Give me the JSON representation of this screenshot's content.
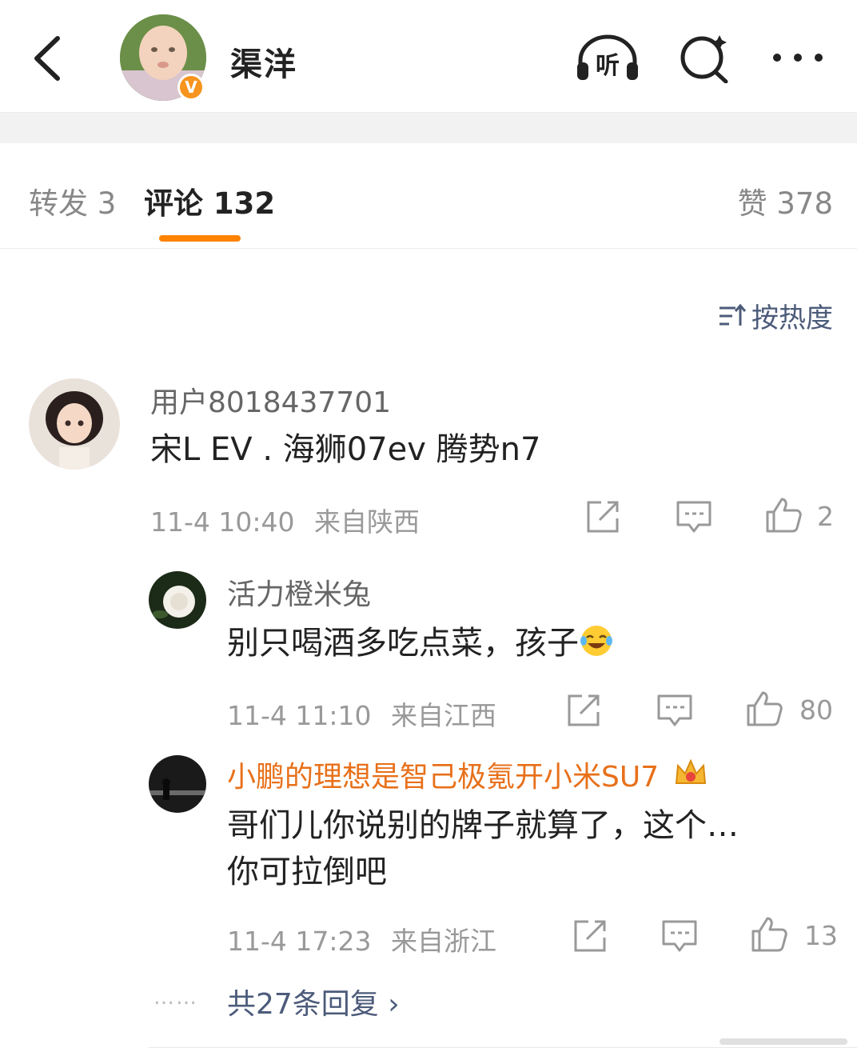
{
  "header": {
    "title": "渠洋",
    "verified_badge": "V",
    "listen_label": "听"
  },
  "tabs": {
    "repost": "转发 3",
    "comments": "评论 132",
    "likes": "赞 378"
  },
  "sort": {
    "label": "按热度"
  },
  "comments": [
    {
      "user": "用户8018437701",
      "text": "宋L EV  . 海狮07ev  腾势n7",
      "time": "11-4 10:40",
      "location": "来自陕西",
      "likes": "2"
    }
  ],
  "replies": [
    {
      "user": "活力橙米兔",
      "text": "别只喝酒多吃点菜，孩子",
      "emoji": "laughing-crying-emoji",
      "time": "11-4 11:10",
      "location": "来自江西",
      "likes": "80"
    },
    {
      "user": "小鹏的理想是智己极氪开小米SU7",
      "user_color": "#e8701a",
      "text_line1": "哥们儿你说别的牌子就算了，这个…",
      "text_line2": "你可拉倒吧",
      "time": "11-4 17:23",
      "location": "来自浙江",
      "likes": "13"
    }
  ],
  "more_replies": {
    "label": "共27条回复 ›",
    "dots": "……"
  },
  "colors": {
    "accent": "#ff8200",
    "link": "#4c5b7a",
    "meta": "#999999"
  }
}
